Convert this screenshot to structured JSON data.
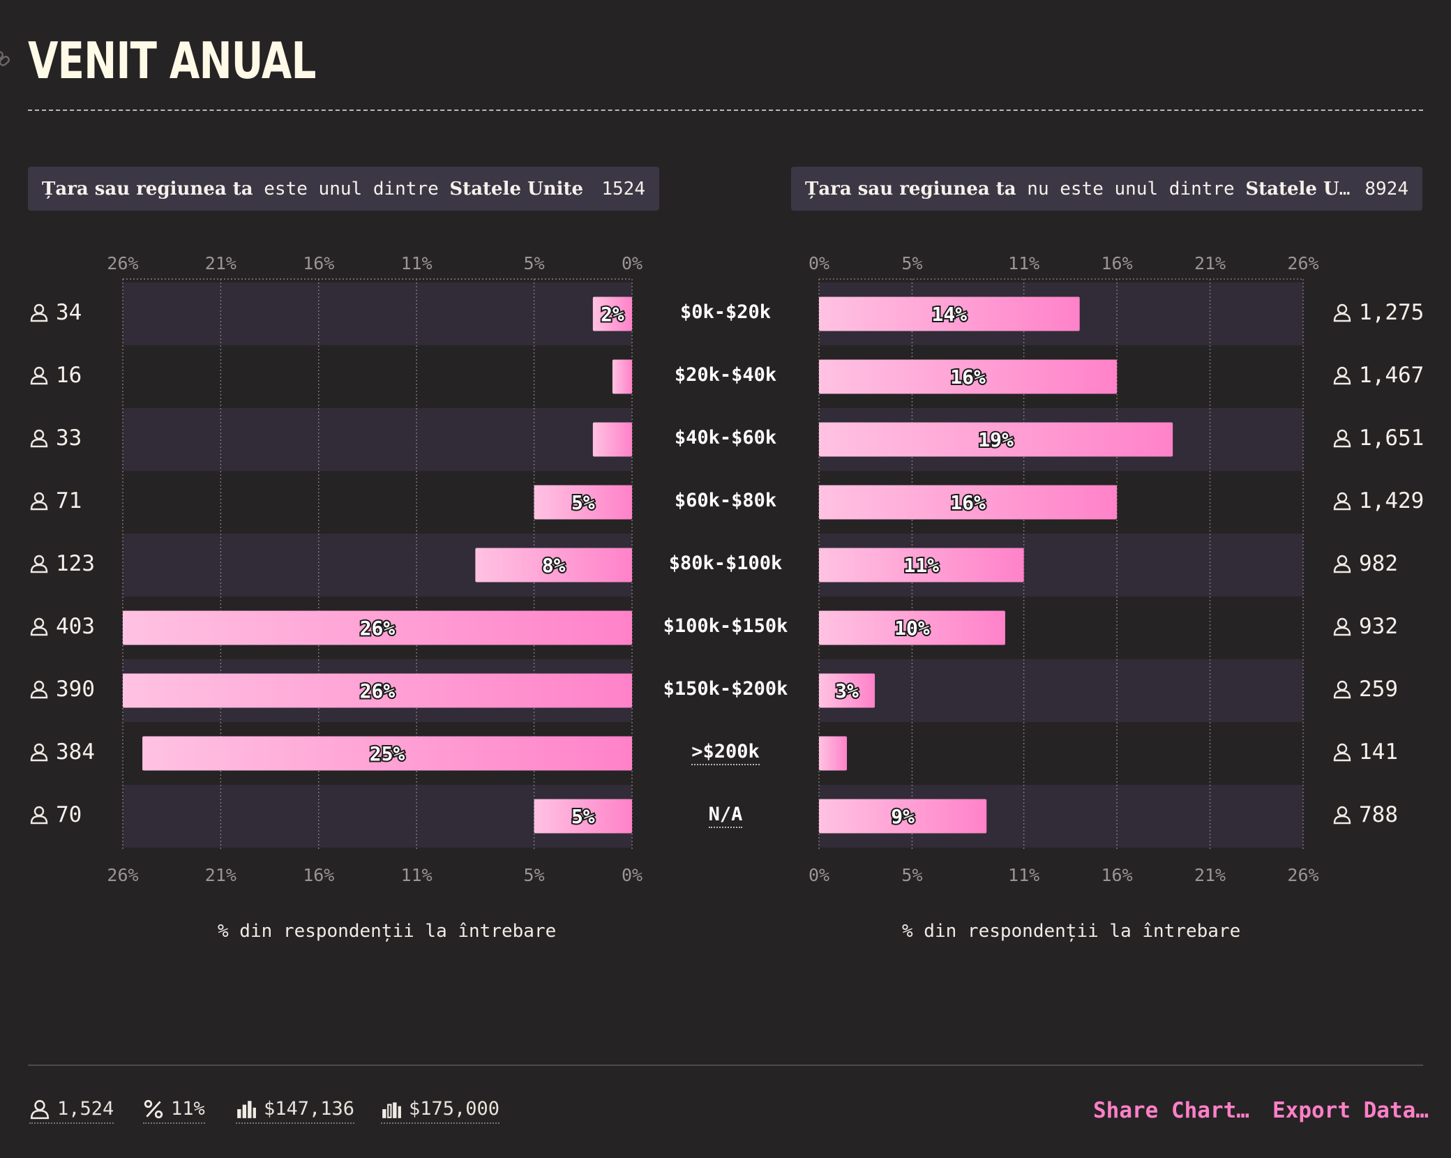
{
  "title": "VENIT ANUAL",
  "icons": {
    "link": "link-icon",
    "person": "user-icon",
    "percent": "percent-icon",
    "mean": "bar-chart-icon",
    "median": "median-bar-icon"
  },
  "colors": {
    "background": "#262324",
    "bar_start": "#ffc2e2",
    "bar_end": "#ff82c9",
    "band": "#312c37",
    "accent": "#ff80c8"
  },
  "panels": [
    {
      "label_bold_1": "Țara sau regiunea ta",
      "label_mid": " este unul dintre ",
      "label_bold_2": "Statele Unite",
      "count": "1524"
    },
    {
      "label_bold_1": "Țara sau regiunea ta",
      "label_mid": " nu este unul dintre ",
      "label_bold_2": "Statele Unite",
      "count": "8924"
    }
  ],
  "axis_title": "% din respondenții la întrebare",
  "chart_data": [
    {
      "type": "bar",
      "orientation": "horizontal",
      "direction": "right-to-left",
      "panel": "Țara sau regiunea ta este unul dintre Statele Unite",
      "categories": [
        "$0k-$20k",
        "$20k-$40k",
        "$40k-$60k",
        "$60k-$80k",
        "$80k-$100k",
        "$100k-$150k",
        "$150k-$200k",
        ">$200k",
        "N/A"
      ],
      "values": [
        2,
        1,
        2,
        5,
        8,
        26,
        26,
        25,
        5
      ],
      "value_labels": [
        "2%",
        "",
        "",
        "5%",
        "8%",
        "26%",
        "26%",
        "25%",
        "5%"
      ],
      "counts": [
        "34",
        "16",
        "33",
        "71",
        "123",
        "403",
        "390",
        "384",
        "70"
      ],
      "xticks": [
        "26%",
        "21%",
        "16%",
        "11%",
        "5%",
        "0%"
      ],
      "xlim": [
        0,
        26
      ],
      "xlabel": "% din respondenții la întrebare",
      "grid": true
    },
    {
      "type": "bar",
      "orientation": "horizontal",
      "direction": "left-to-right",
      "panel": "Țara sau regiunea ta nu este unul dintre Statele Unite",
      "categories": [
        "$0k-$20k",
        "$20k-$40k",
        "$40k-$60k",
        "$60k-$80k",
        "$80k-$100k",
        "$100k-$150k",
        "$150k-$200k",
        ">$200k",
        "N/A"
      ],
      "values": [
        14,
        16,
        19,
        16,
        11,
        10,
        3,
        1.5,
        9
      ],
      "value_labels": [
        "14%",
        "16%",
        "19%",
        "16%",
        "11%",
        "10%",
        "3%",
        "",
        "9%"
      ],
      "counts": [
        "1,275",
        "1,467",
        "1,651",
        "1,429",
        "982",
        "932",
        "259",
        "141",
        "788"
      ],
      "xticks": [
        "0%",
        "5%",
        "11%",
        "16%",
        "21%",
        "26%"
      ],
      "xlim": [
        0,
        26
      ],
      "xlabel": "% din respondenții la întrebare",
      "grid": true
    }
  ],
  "categories": [
    "$0k-$20k",
    "$20k-$40k",
    "$40k-$60k",
    "$60k-$80k",
    "$80k-$100k",
    "$100k-$150k",
    "$150k-$200k",
    ">$200k",
    "N/A"
  ],
  "footer": {
    "respondents": "1,524",
    "percent": "11%",
    "mean": "$147,136",
    "median": "$175,000",
    "share_label": "Share Chart…",
    "export_label": "Export Data…"
  }
}
